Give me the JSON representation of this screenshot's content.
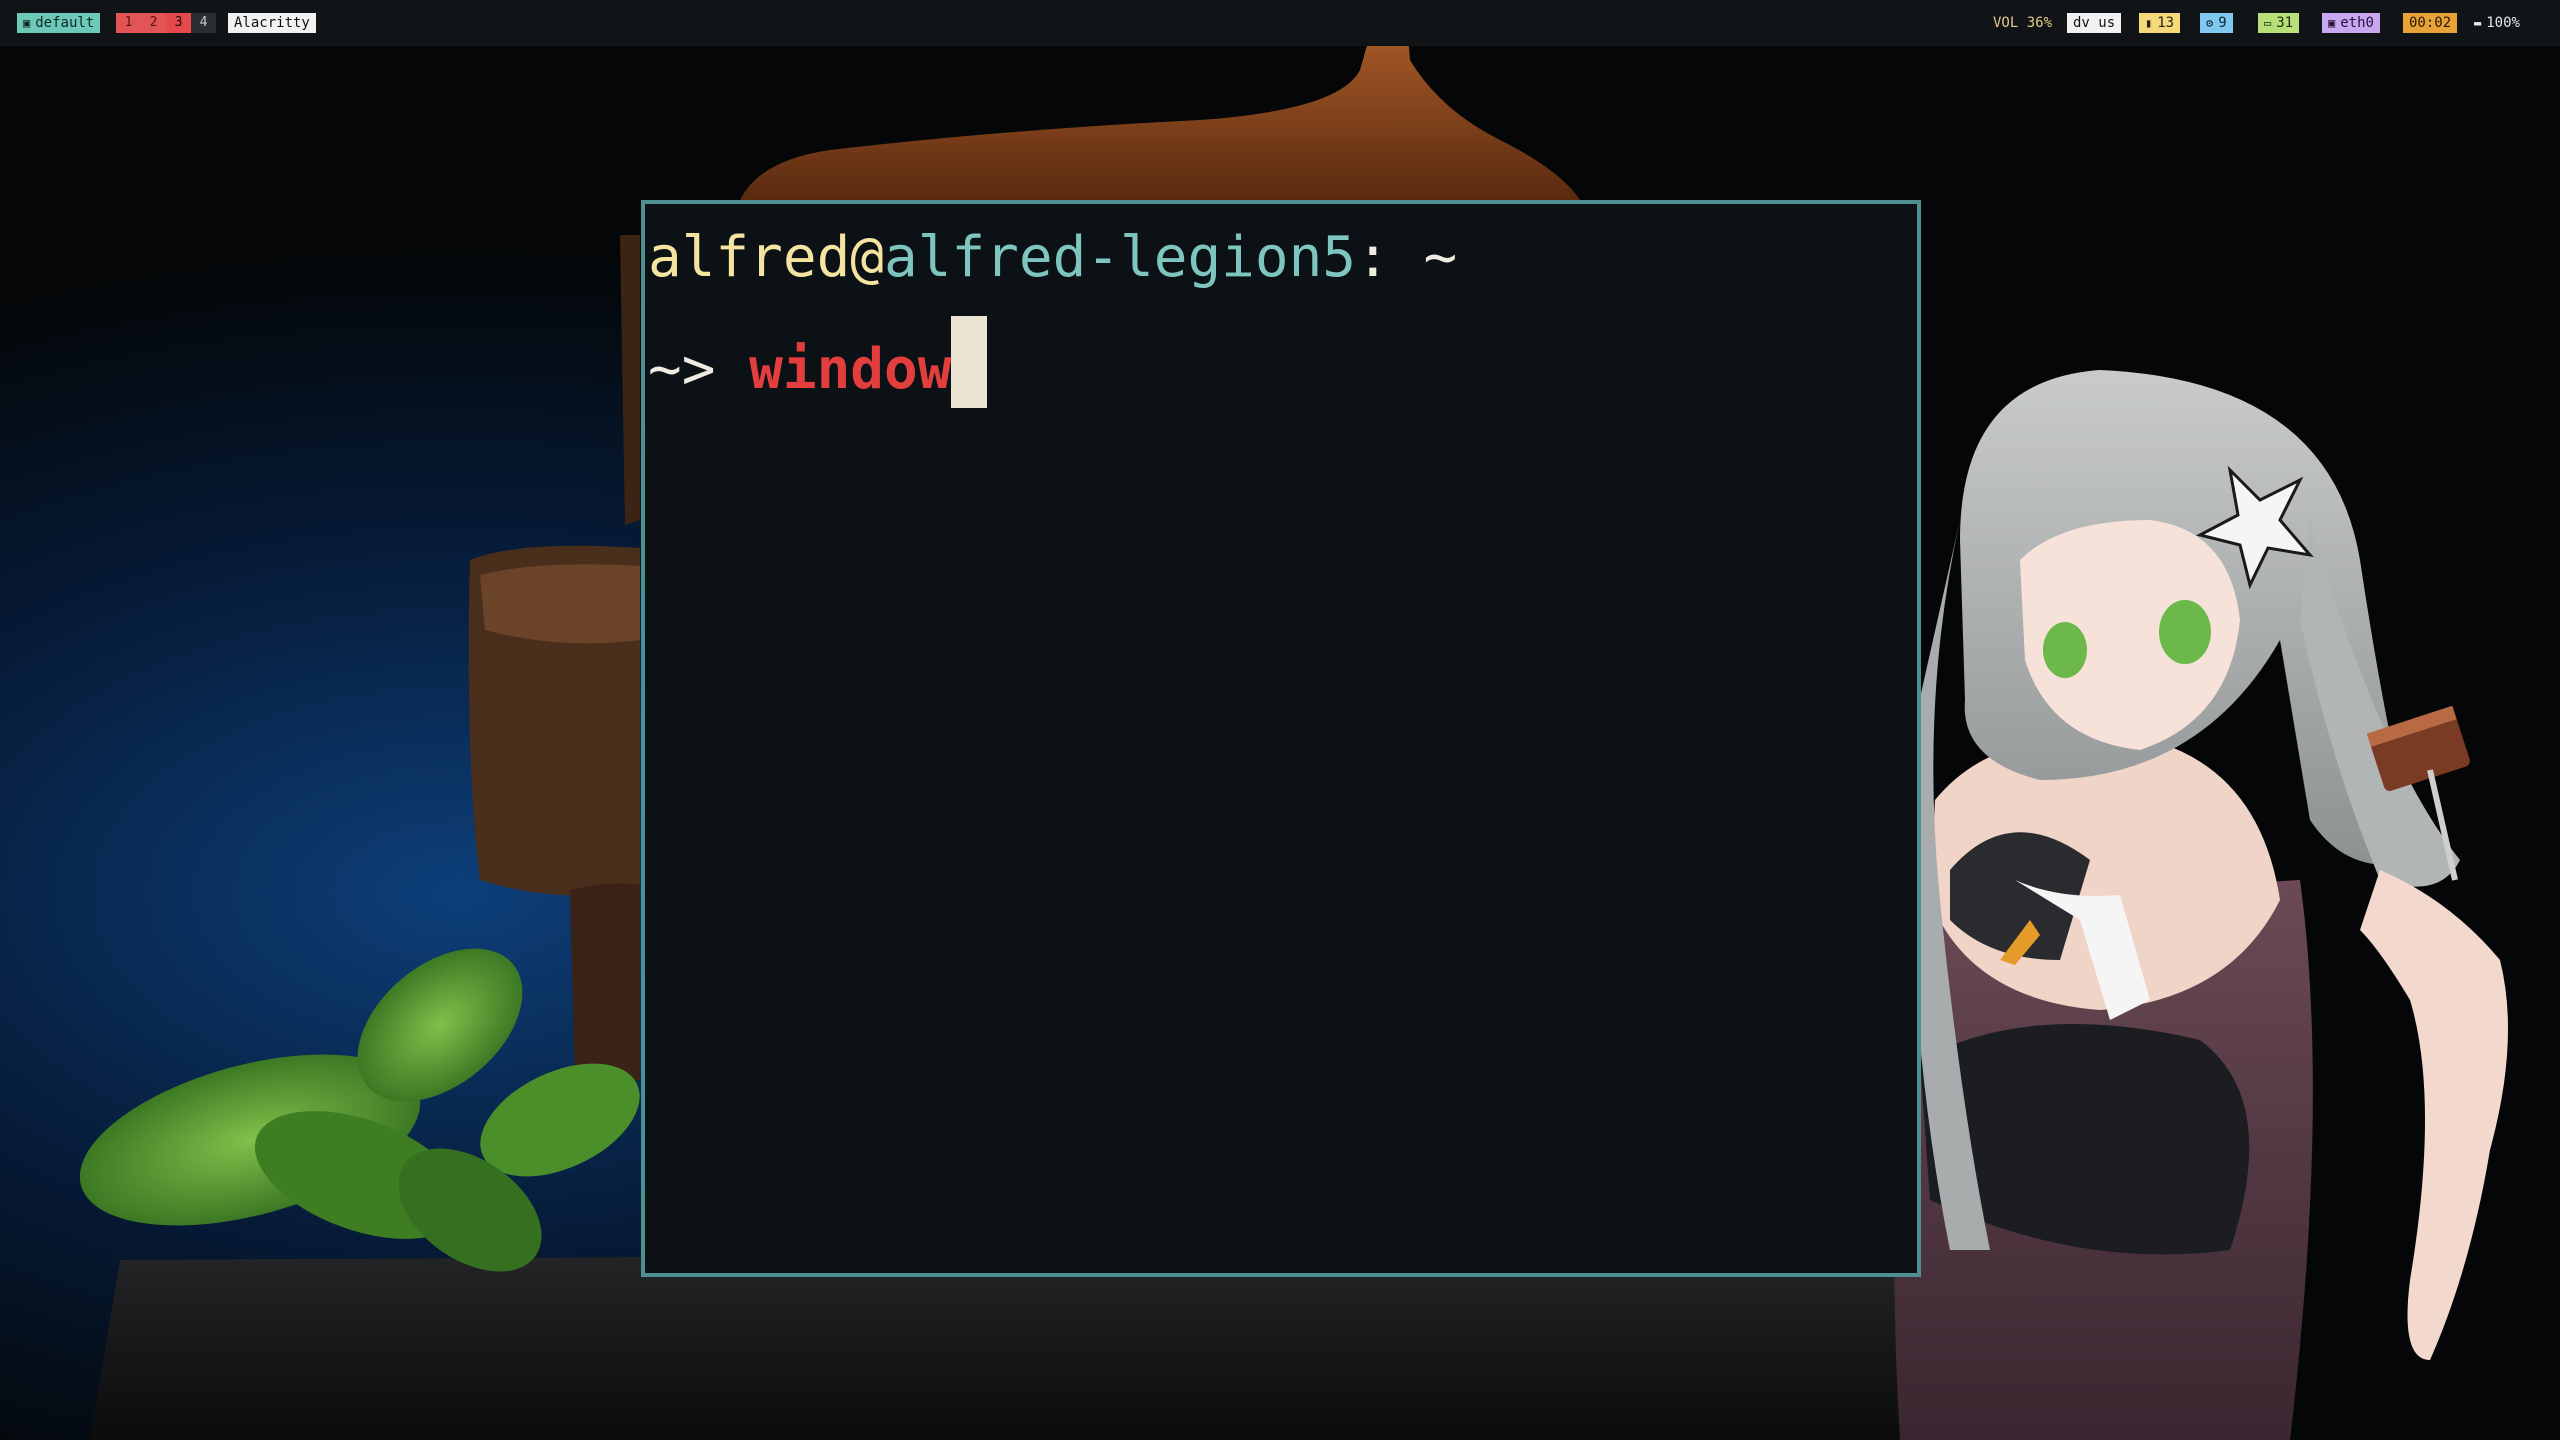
{
  "topbar": {
    "layout_label": "default",
    "layout_icon": "layout-icon",
    "workspaces": [
      "1",
      "2",
      "3",
      "4"
    ],
    "active_workspace": "3",
    "window_title": "Alacritty",
    "volume": "VOL 36%",
    "keyboard_layout": "dv us",
    "memory": "13",
    "memory_icon": "memory-icon",
    "cpu": "9",
    "cpu_icon": "cpu-icon",
    "display": "31",
    "display_icon": "monitor-icon",
    "network": "eth0",
    "network_icon": "network-icon",
    "clock": "00:02",
    "battery": "100%",
    "battery_icon": "battery-icon"
  },
  "terminal": {
    "user": "alfred",
    "at": "@",
    "host": "alfred-legion5",
    "colon": ":",
    "cwd": "~",
    "prompt": "~>",
    "command": "window"
  },
  "colors": {
    "terminal_border": "#4e8f91",
    "terminal_bg": "#0b1115",
    "user": "#f4e4a0",
    "host": "#7fc5bf",
    "command": "#e33e3e",
    "cursor": "#ece4d2"
  }
}
